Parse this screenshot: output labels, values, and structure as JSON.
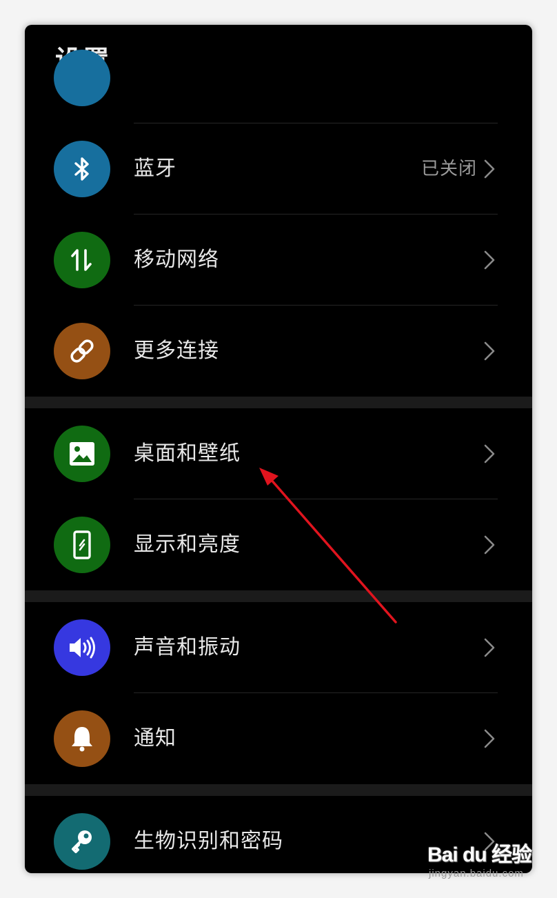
{
  "header": {
    "title": "设置"
  },
  "items": [
    {
      "label": "蓝牙",
      "status": "已关闭",
      "icon": "bluetooth-icon",
      "color": "#176f9e"
    },
    {
      "label": "移动网络",
      "status": "",
      "icon": "mobile-data-icon",
      "color": "#106b12"
    },
    {
      "label": "更多连接",
      "status": "",
      "icon": "link-icon",
      "color": "#955014"
    },
    {
      "label": "桌面和壁纸",
      "status": "",
      "icon": "wallpaper-icon",
      "color": "#106b12"
    },
    {
      "label": "显示和亮度",
      "status": "",
      "icon": "display-brightness-icon",
      "color": "#106b12"
    },
    {
      "label": "声音和振动",
      "status": "",
      "icon": "speaker-icon",
      "color": "#3638e0"
    },
    {
      "label": "通知",
      "status": "",
      "icon": "bell-icon",
      "color": "#955014"
    },
    {
      "label": "生物识别和密码",
      "status": "",
      "icon": "key-icon",
      "color": "#136b72"
    }
  ],
  "annotation": {
    "color": "#e0141e"
  },
  "watermark": {
    "logo": "Bai du 经验",
    "url": "jingyan.baidu.com"
  }
}
